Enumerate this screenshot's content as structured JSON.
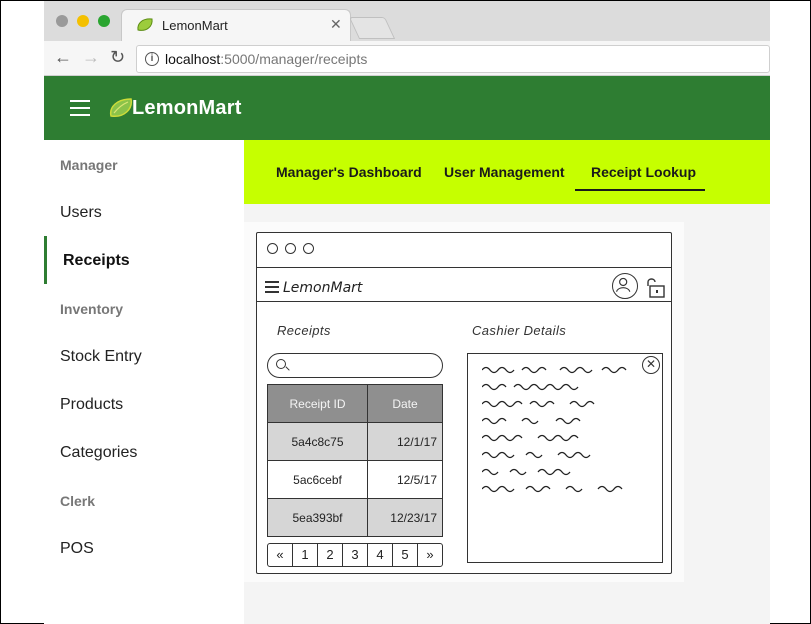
{
  "browser": {
    "tab_title": "LemonMart",
    "url_host": "localhost",
    "url_rest": ":5000/manager/receipts",
    "controls": {
      "back": "back-arrow-icon",
      "forward": "forward-arrow-icon",
      "reload": "reload-icon",
      "info": "info-icon"
    },
    "traffic_colors": [
      "#9a9a9a",
      "#f4c000",
      "#2aa530"
    ]
  },
  "app": {
    "title": "LemonMart",
    "toolbar_color": "#2e7d32",
    "accent_color": "#c6ff00"
  },
  "sidebar": {
    "sections": [
      {
        "header": "Manager",
        "items": [
          "Users",
          "Receipts"
        ]
      },
      {
        "header": "Inventory",
        "items": [
          "Stock Entry",
          "Products",
          "Categories"
        ]
      },
      {
        "header": "Clerk",
        "items": [
          "POS"
        ]
      }
    ],
    "active_item": "Receipts"
  },
  "nav_tabs": {
    "items": [
      "Manager's Dashboard",
      "User Management",
      "Receipt Lookup"
    ],
    "active": "Receipt Lookup"
  },
  "wireframe": {
    "app_title": "LemonMart",
    "receipts_heading": "Receipts",
    "details_heading": "Cashier Details",
    "table": {
      "columns": [
        "Receipt ID",
        "Date"
      ],
      "rows": [
        [
          "5a4c8c75",
          "12/1/17"
        ],
        [
          "5ac6cebf",
          "12/5/17"
        ],
        [
          "5ea393bf",
          "12/23/17"
        ]
      ]
    },
    "pager": [
      "«",
      "1",
      "2",
      "3",
      "4",
      "5",
      "»"
    ]
  }
}
